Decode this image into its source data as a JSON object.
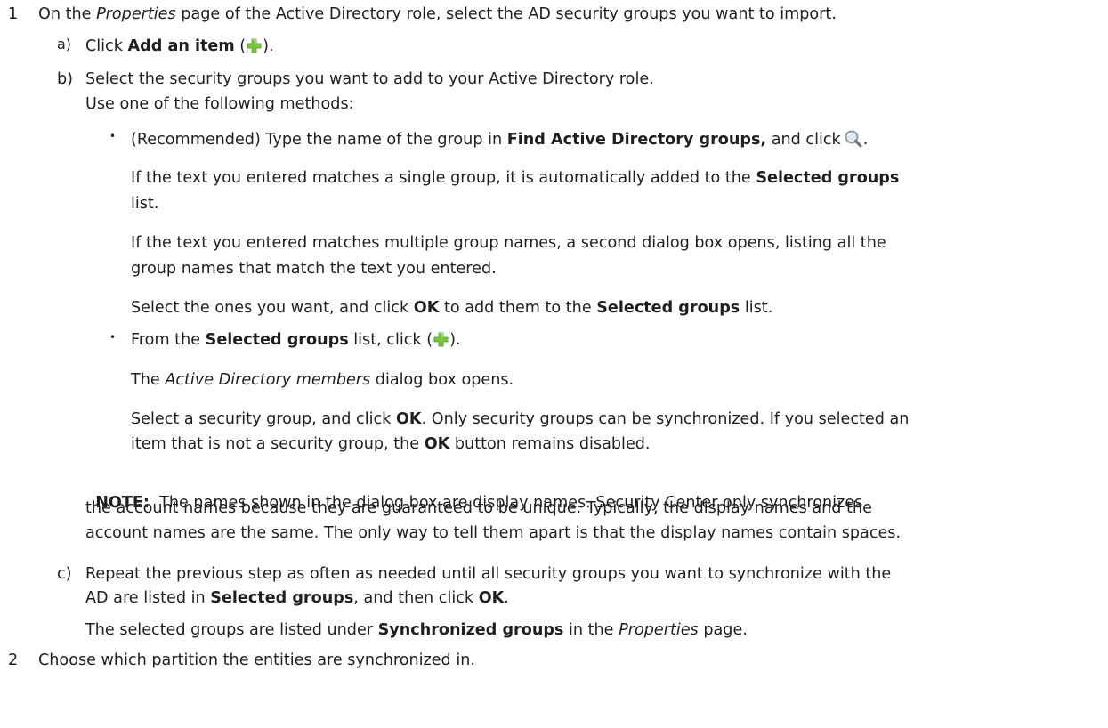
{
  "step1": {
    "num": "1",
    "pre": "On the ",
    "em": "Properties",
    "post": " page of the Active Directory role, select the AD security groups you want to import."
  },
  "sub_a": {
    "label": "a)",
    "pre": "Click ",
    "bold": "Add an item",
    "open": " (",
    "close": ")."
  },
  "sub_b": {
    "label": "b)",
    "text": "Select the security groups you want to add to your Active Directory role.",
    "line2": "Use one of the following methods:"
  },
  "bullet1": {
    "pre": "(Recommended) Type the name of the group in ",
    "bold": "Find Active Directory groups,",
    "post": " and click",
    "end": ".",
    "p1_pre": "If the text you entered matches a single group, it is automatically added to the ",
    "p1_bold": "Selected groups",
    "p1_line2": "list.",
    "p2_line1": "If the text you entered matches multiple group names, a second dialog box opens, listing all the",
    "p2_line2": "group names that match the text you entered.",
    "p3_pre": "Select the ones you want, and click ",
    "p3_ok": "OK",
    "p3_mid": " to add them to the ",
    "p3_bold": "Selected groups",
    "p3_post": " list."
  },
  "bullet2": {
    "pre": "From the ",
    "bold": "Selected groups",
    "mid": " list, click (",
    "end": ").",
    "p1_em": "Active Directory members",
    "p1_pre": "The ",
    "p1_post": " dialog box opens.",
    "p2_pre": "Select a security group, and click ",
    "p2_ok": "OK",
    "p2_post": ". Only security groups can be synchronized. If you selected an",
    "p2_line2_pre": "item that is not a security group, the ",
    "p2_line2_ok": "OK",
    "p2_line2_post": " button remains disabled."
  },
  "note": {
    "label": "NOTE:",
    "line1": "  The names shown in the dialog box are display names. Security Center only synchronizes",
    "line2": "the account names because they are guaranteed to be unique. Typically, the display names and the",
    "line3": "account names are the same. The only way to tell them apart is that the display names contain spaces."
  },
  "sub_c": {
    "label": "c)",
    "line1": "Repeat the previous step as often as needed until all security groups you want to synchronize with the",
    "line2_pre": "AD are listed in ",
    "line2_bold": "Selected groups",
    "line2_mid": ", and then click ",
    "line2_ok": "OK",
    "line2_end": ".",
    "line3_pre": "The selected groups are listed under ",
    "line3_bold": "Synchronized groups",
    "line3_mid": " in the ",
    "line3_em": "Properties",
    "line3_post": " page."
  },
  "step2": {
    "num": "2",
    "text": "Choose which partition the entities are synchronized in."
  },
  "icons": {
    "plus": "add-item-plus-icon",
    "search": "magnifier-search-icon",
    "plus_color": "#6fbf3a"
  }
}
